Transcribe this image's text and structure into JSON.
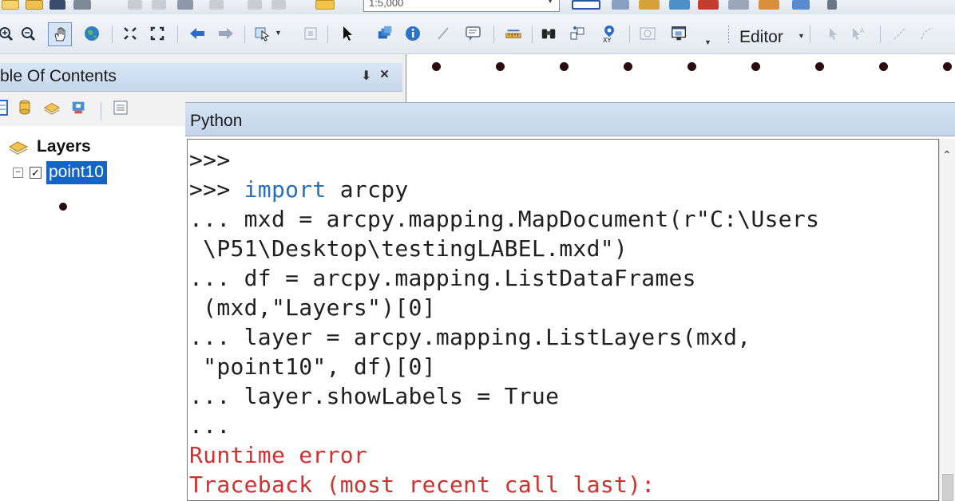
{
  "toolbar": {
    "scale_value": "1:5,000",
    "editor_label": "Editor"
  },
  "toc": {
    "title": "ble Of Contents",
    "pin_glyph": "4",
    "close_glyph": "×",
    "layers_label": "Layers",
    "layer_name": "point10"
  },
  "python": {
    "title": "Python",
    "lines": [
      ">>>",
      ">>> import arcpy",
      "... mxd = arcpy.mapping.MapDocument(r\"C:\\Users",
      " \\P51\\Desktop\\testingLABEL.mxd\")",
      "... df = arcpy.mapping.ListDataFrames",
      " (mxd,\"Layers\")[0]",
      "... layer = arcpy.mapping.ListLayers(mxd,",
      " \"point10\", df)[0]",
      "... layer.showLabels = True",
      "...",
      "Runtime error",
      "Traceback (most recent call last):"
    ],
    "import_keyword": "import"
  },
  "colors": {
    "selection": "#1565c8",
    "error_text": "#d03030",
    "keyword": "#2a6fbd",
    "point_symbol": "#2a0d12"
  }
}
